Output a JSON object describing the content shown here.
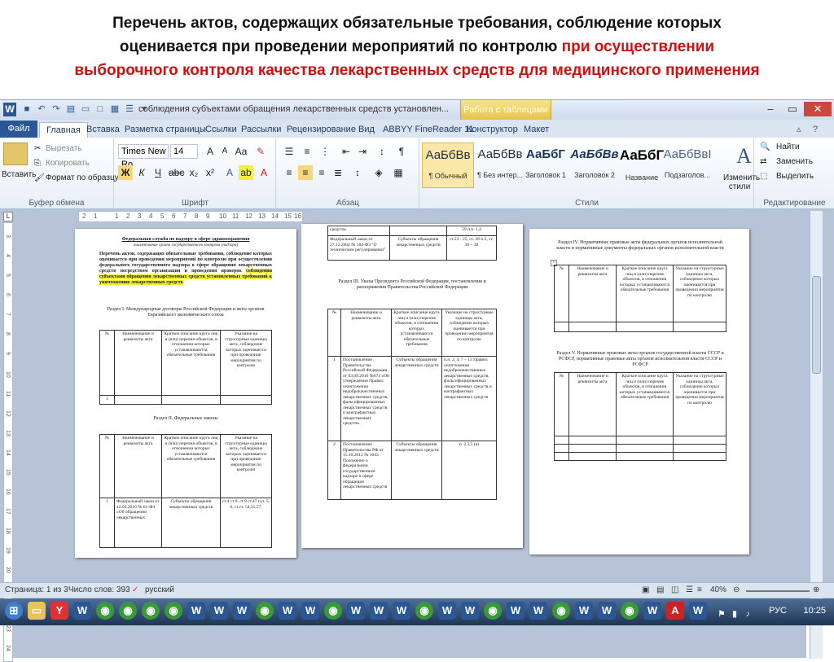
{
  "slide": {
    "title_line1": "Перечень актов, содержащих обязательные требования, соблюдение которых",
    "title_line2a": "оценивается при проведении мероприятий по контролю ",
    "title_line2b": "при осуществлении",
    "title_line3": "выборочного контроля качества лекарственных средств для медицинского применения",
    "accent_color": "#d01010"
  },
  "word": {
    "doc_title": "соблюдения субъектами обращения лекарственных средств установлен...",
    "context_tab": "Работа с таблицами",
    "tabs": [
      "Файл",
      "Главная",
      "Вставка",
      "Разметка страницы",
      "Ссылки",
      "Рассылки",
      "Рецензирование",
      "Вид",
      "ABBYY FineReader 11",
      "Конструктор",
      "Макет"
    ],
    "clipboard": {
      "paste": "Вставить",
      "cut": "Вырезать",
      "copy": "Копировать",
      "format": "Формат по образцу",
      "name": "Буфер обмена"
    },
    "font": {
      "family": "Times New Ro",
      "size": "14",
      "name": "Шрифт",
      "bold": "Ж",
      "italic": "К",
      "underline": "Ч"
    },
    "paragraph": {
      "name": "Абзац"
    },
    "styles": {
      "name": "Стили",
      "items": [
        {
          "sample": "АаБбВв",
          "label": "¶ Обычный"
        },
        {
          "sample": "АаБбВв",
          "label": "¶ Без интер..."
        },
        {
          "sample": "АаБбГ",
          "label": "Заголовок 1"
        },
        {
          "sample": "АаБбВв",
          "label": "Заголовок 2"
        },
        {
          "sample": "АаБбГ",
          "label": "Название"
        },
        {
          "sample": "АаБбВвІ",
          "label": "Подзаголов..."
        }
      ],
      "change": "Изменить стили"
    },
    "editing": {
      "find": "Найти",
      "replace": "Заменить",
      "select": "Выделить",
      "name": "Редактирование"
    },
    "ruler": [
      "2",
      "1",
      "1",
      "2",
      "3",
      "4",
      "5",
      "6",
      "7",
      "8",
      "9",
      "10",
      "11",
      "12",
      "13",
      "14",
      "15",
      "16"
    ],
    "vruler": [
      "3",
      "4",
      "5",
      "6",
      "7",
      "8",
      "9",
      "10",
      "11",
      "12",
      "13",
      "14",
      "15",
      "16",
      "17",
      "18",
      "19",
      "20",
      "21",
      "22",
      "23",
      "24"
    ],
    "status": {
      "page": "Страница: 1 из 3",
      "words": "Число слов: 393",
      "lang": "русский",
      "zoom": "40%"
    },
    "taskbar": {
      "lang": "РУС",
      "time": "10:25"
    }
  },
  "doc": {
    "p1": {
      "header1": "Федеральная служба по надзору в сфере здравоохранения",
      "header2": "наименование органа государственного контроля (надзора)",
      "intro": "Перечень актов, содержащих обязательные требования, соблюдение которых оценивается при проведении мероприятий по контролю при осуществлении федерального государственного надзора в сфере обращения лекарственных средств посредством организации и проведения проверок",
      "intro_hl": "соблюдения субъектами обращения лекарственных средств установленных требований к уничтожению лекарственных средств",
      "sec1": "Раздел I. Международные договоры Российской Федерации и акты органов Евразийского экономического союза",
      "th": [
        "№",
        "Наименование и реквизиты акта",
        "Краткое описание круга лиц и (или) перечня объектов, в отношении которых устанавливаются обязательные требования",
        "Указание на структурные единицы акта, соблюдение которых оценивается при проведении мероприятия по контролю"
      ],
      "r1": "1",
      "sec2": "Раздел II. Федеральные законы",
      "r2": [
        "1",
        "Федеральный закон от 12.04.2010 № 61-ФЗ «Об обращении лекарственных",
        "Субъекты обращения лекарственных средств",
        "ст.4 ст.9, ст.9 ст.47 п.п. 5, 6; ст.ст. 54,55,57,"
      ]
    },
    "p2": {
      "top": [
        "средств»",
        "",
        "59 п.п. 1,4"
      ],
      "r1": [
        "Федеральный закон от 27.12.2002 № 184-ФЗ \"О техническом регулировании\"",
        "Субъекты обращения лекарственных средств",
        "ст.23 - 25, ст. 28 п.2, ст. 36 – 38"
      ],
      "sec3": "Раздел III. Указы Президента Российской Федерации, постановления и распоряжения Правительства Российской Федерации",
      "th": [
        "№",
        "Наименование и реквизиты акта",
        "Краткое описание круга лиц и (или) перечня объектов, в отношении которых устанавливаются обязательные требования",
        "Указание на структурные единицы акта, соблюдение которых оценивается при проведении мероприятия по контролю"
      ],
      "r2": [
        "1",
        "Постановление Правительства Российской Федерации от 03.09.2010 №674 «Об утверждении Правил уничтожения недоброкачественных лекарственных средств, фальсифицированных лекарственных средств и контрафактных лекарственных средств»",
        "Субъекты обращения лекарственных средств",
        "п.п. 2, 4, 7 – 13 Правил уничтожения недоброкачественных лекарственных средств, фальсифицированных лекарственных средств и контрафактных лекарственных средств"
      ],
      "r3": [
        "2",
        "Постановление Правительства РФ от 15.10.2012 № 1043 Положение о федеральном государственном надзоре в сфере обращения лекарственных средств",
        "Субъекты обращения лекарственных средств",
        "п. 2,3,5 (в)"
      ]
    },
    "p3": {
      "sec4": "Раздел IV. Нормативные правовые акты федеральных органов исполнительной власти и нормативные документы федеральных органов исполнительной власти",
      "th": [
        "№",
        "Наименование и реквизиты акта",
        "Краткое описание круга лиц и (или) перечня объектов, в отношении которых устанавливаются обязательные требования",
        "Указание на структурные единицы акта, соблюдение которых оценивается при проведении мероприятия по контролю"
      ],
      "sec5": "Раздел V. Нормативные правовые акты органов государственной власти СССР и РСФСР, нормативные правовые акты органов исполнительной власти СССР и РСФСР"
    }
  }
}
